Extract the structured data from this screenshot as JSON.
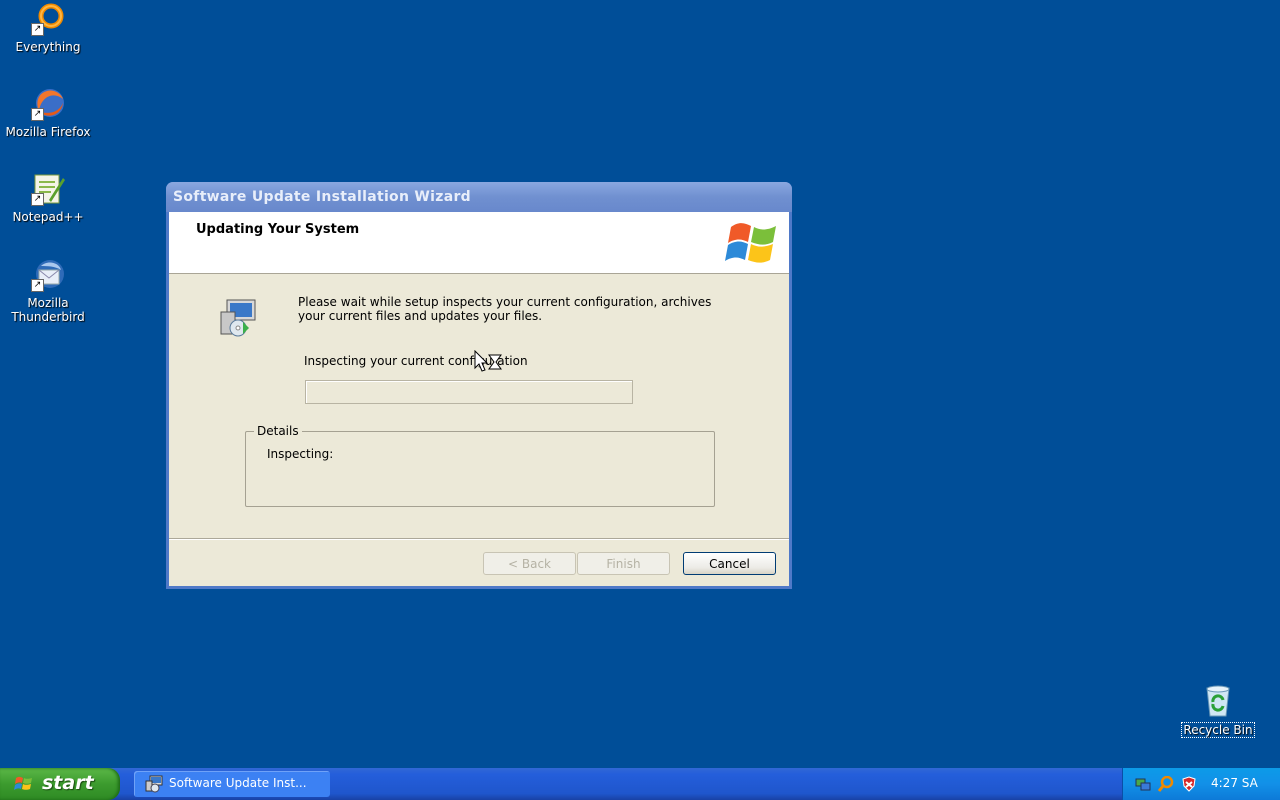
{
  "desktop": {
    "icons": [
      {
        "label": "Everything",
        "icon": "everything-icon"
      },
      {
        "label": "Mozilla Firefox",
        "icon": "firefox-icon"
      },
      {
        "label": "Notepad++",
        "icon": "notepadpp-icon"
      },
      {
        "label": "Mozilla Thunderbird",
        "icon": "thunderbird-icon"
      }
    ],
    "recycle_bin": {
      "label": "Recycle Bin",
      "icon": "recycle-bin-icon"
    }
  },
  "window": {
    "title": "Software Update Installation Wizard",
    "header_title": "Updating Your System",
    "message": "Please wait while setup inspects your current configuration, archives your current files and updates your files.",
    "status": "Inspecting your current configuration",
    "progress": 0,
    "details": {
      "legend": "Details",
      "text": "Inspecting:"
    },
    "buttons": {
      "back": "< Back",
      "finish": "Finish",
      "cancel": "Cancel"
    }
  },
  "taskbar": {
    "start_label": "start",
    "task_button": "Software Update Inst...",
    "clock": "4:27 SA"
  },
  "colors": {
    "desktop": "#004e98",
    "taskbar": "#245edb",
    "start": "#3c9b2e",
    "dialog": "#ece9d8"
  }
}
